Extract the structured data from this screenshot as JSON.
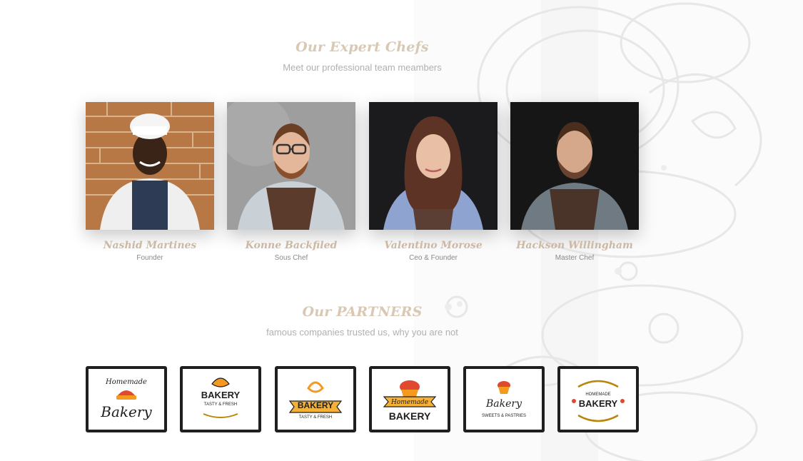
{
  "team": {
    "title": "Our Expert Chefs",
    "subtitle": "Meet our professional team meambers",
    "members": [
      {
        "name": "Nashid Martines",
        "role": "Founder"
      },
      {
        "name": "Konne Backfiled",
        "role": "Sous Chef"
      },
      {
        "name": "Valentino Morose",
        "role": "Ceo & Founder"
      },
      {
        "name": "Hackson Willingham",
        "role": "Master Chef"
      }
    ]
  },
  "partners": {
    "title": "Our PARTNERS",
    "subtitle": "famous companies trusted us, why you are not",
    "logos": [
      {
        "line1": "Homemade",
        "line2": "Bakery",
        "icon": "pie-icon"
      },
      {
        "line1": "BAKERY",
        "line2": "TASTY & FRESH",
        "icon": "croissant-icon"
      },
      {
        "line1": "BAKERY",
        "line2": "TASTY & FRESH",
        "icon": "pretzel-icon"
      },
      {
        "line1": "Homemade",
        "line2": "BAKERY",
        "icon": "cupcake-icon"
      },
      {
        "line1": "Bakery",
        "line2": "SWEETS & PASTRIES",
        "icon": "muffin-icon"
      },
      {
        "line1": "HOMEMADE",
        "line2": "BAKERY",
        "icon": "wheat-wreath-icon"
      }
    ]
  },
  "colors": {
    "title": "#d9c9b4",
    "name": "#cbb9a4",
    "frame": "#1f1f1f",
    "logo_orange": "#f39a1f",
    "logo_red": "#e0482f"
  }
}
